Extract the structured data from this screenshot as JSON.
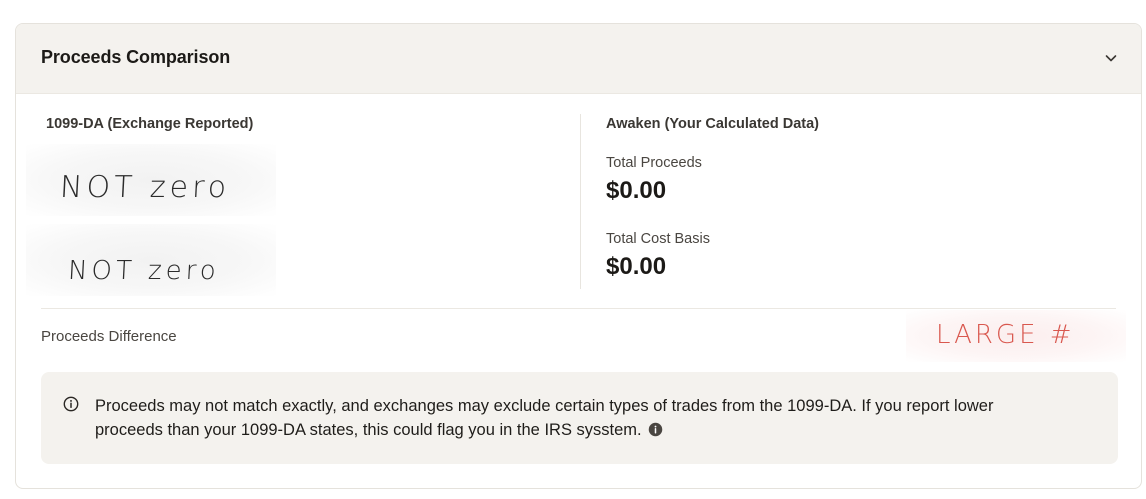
{
  "panel": {
    "title": "Proceeds Comparison",
    "collapse_icon": "chevron-down-icon"
  },
  "exchange_reported": {
    "title": "1099-DA (Exchange Reported)",
    "handwritten_proceeds": "NOT zero",
    "handwritten_cost_basis": "NOT zero"
  },
  "calculated": {
    "title": "Awaken (Your Calculated Data)",
    "total_proceeds_label": "Total Proceeds",
    "total_proceeds_value": "$0.00",
    "total_cost_basis_label": "Total Cost Basis",
    "total_cost_basis_value": "$0.00"
  },
  "difference": {
    "label": "Proceeds Difference",
    "handwritten_note": "LARGE #"
  },
  "notice": {
    "icon": "info-circle-icon",
    "text": "Proceeds may not match exactly, and exchanges may exclude certain types of trades from the 1099-DA. If you report lower proceeds than your 1099-DA states, this could flag you in the IRS sysstem.",
    "tooltip_icon": "info-filled-icon"
  },
  "colors": {
    "header_bg": "#f4f2ee",
    "notice_bg": "#f4f2ee",
    "annotation_red": "#d9584f"
  }
}
